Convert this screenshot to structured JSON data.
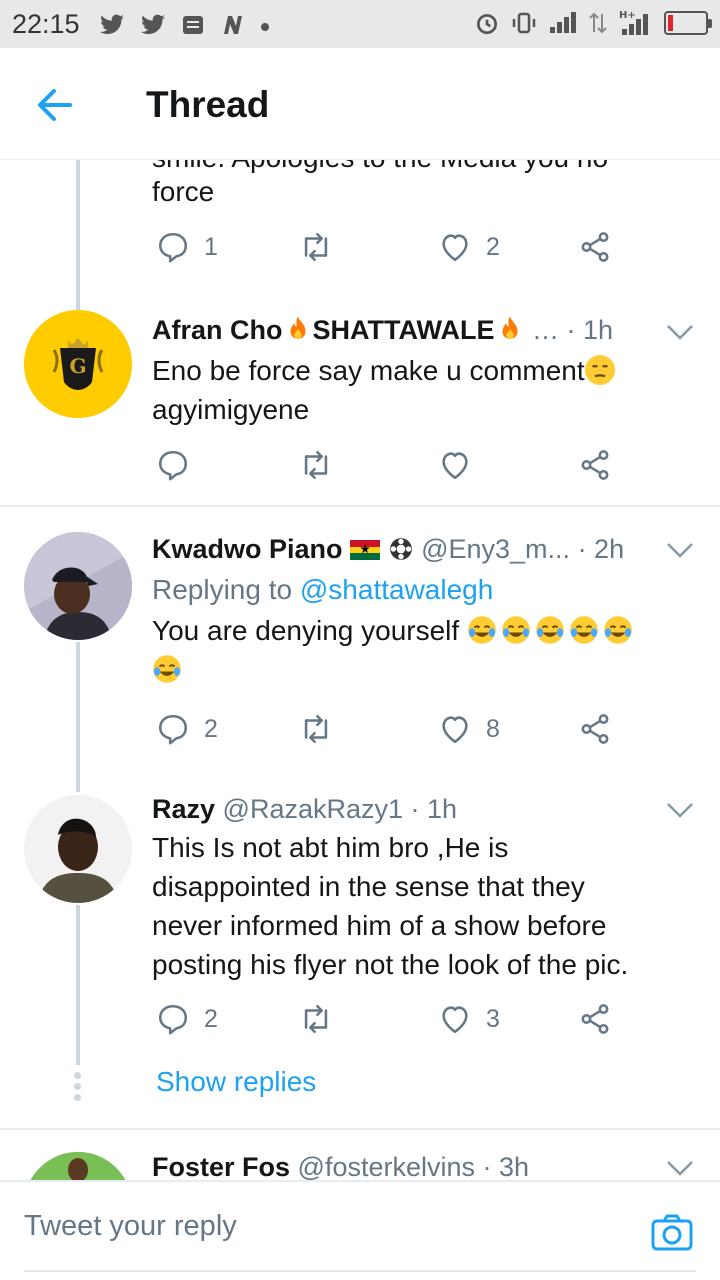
{
  "status_bar": {
    "time": "22:15",
    "left_icons": [
      "twitter-icon",
      "twitter-icon",
      "message-icon",
      "n-icon",
      "dot"
    ],
    "right_icons": [
      "alarm-icon",
      "vibrate-icon",
      "signal-icon",
      "data-icon",
      "h-plus-signal-icon",
      "battery-icon"
    ],
    "battery_level": 0.1
  },
  "header": {
    "title": "Thread",
    "accent": "#1da1f2"
  },
  "top_tweet": {
    "cut_text": "smile. Apologies to the Media you no",
    "last_line": "force",
    "replies": "1",
    "retweets": "",
    "likes": "2"
  },
  "tweets": [
    {
      "name": "Afran Cho",
      "name_suffix": "SHATTAWALE",
      "handle": "…",
      "time": "· 1h",
      "replying_to": "",
      "text_line1": "Eno be force say make u comment",
      "text_line2": "agyimigyene",
      "replies": "",
      "retweets": "",
      "likes": "",
      "avatar": "gold-logo-avatar"
    },
    {
      "name": "Kwadwo Piano",
      "handle": "@Eny3_m...",
      "time": "· 2h",
      "replying_prefix": "Replying to",
      "replying_to": "@shattawalegh",
      "text": "You are denying yourself",
      "replies": "2",
      "retweets": "",
      "likes": "8",
      "avatar": "person-avatar"
    },
    {
      "name": "Razy",
      "handle": "@RazakRazy1",
      "time": "· 1h",
      "text_lines": [
        "This Is not abt him bro ,He is",
        "disappointed in the sense that they",
        "never informed him of a show before",
        "posting his flyer not the look of the pic."
      ],
      "replies": "2",
      "retweets": "",
      "likes": "3",
      "avatar": "person-avatar"
    },
    {
      "name": "Foster Fos",
      "handle": "@fosterkelvins",
      "time": "· 3h",
      "avatar": "person-avatar"
    }
  ],
  "show_replies": "Show replies",
  "compose": {
    "placeholder": "Tweet your reply"
  }
}
